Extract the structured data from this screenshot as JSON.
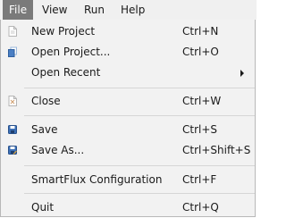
{
  "menubar": {
    "file": "File",
    "view": "View",
    "run": "Run",
    "help": "Help"
  },
  "file_menu": {
    "new_project": {
      "label": "New Project",
      "shortcut": "Ctrl+N",
      "icon": "new-file-icon"
    },
    "open_project": {
      "label": "Open Project...",
      "shortcut": "Ctrl+O",
      "icon": "open-folder-icon"
    },
    "open_recent": {
      "label": "Open Recent",
      "icon": "submenu-arrow-icon"
    },
    "close": {
      "label": "Close",
      "shortcut": "Ctrl+W",
      "icon": "close-file-icon"
    },
    "save": {
      "label": "Save",
      "shortcut": "Ctrl+S",
      "icon": "save-icon"
    },
    "save_as": {
      "label": "Save As...",
      "shortcut": "Ctrl+Shift+S",
      "icon": "save-as-icon"
    },
    "smartflux": {
      "label": "SmartFlux Configuration",
      "shortcut": "Ctrl+F"
    },
    "quit": {
      "label": "Quit",
      "shortcut": "Ctrl+Q"
    }
  },
  "colors": {
    "menubar_bg": "#f0f0f0",
    "active_menu_bg": "#7a7a7a",
    "menu_bg": "#f2f2f2",
    "separator": "#d6d6d6",
    "save_icon_blue": "#3b6fb6"
  }
}
